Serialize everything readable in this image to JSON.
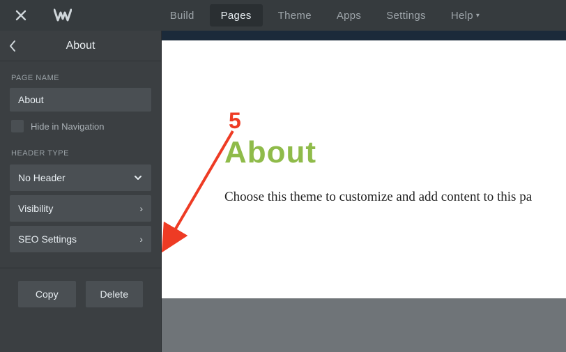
{
  "topnav": {
    "tabs": [
      "Build",
      "Pages",
      "Theme",
      "Apps",
      "Settings",
      "Help"
    ],
    "active_index": 1
  },
  "sidepanel": {
    "title": "About",
    "page_name_label": "PAGE NAME",
    "page_name_value": "About",
    "hide_nav_label": "Hide in Navigation",
    "hide_nav_checked": false,
    "header_type_label": "HEADER TYPE",
    "header_type_value": "No Header",
    "rows": [
      "Visibility",
      "SEO Settings"
    ],
    "buttons": {
      "copy": "Copy",
      "delete": "Delete"
    }
  },
  "page_preview": {
    "heading": "About",
    "body": "Choose this theme to customize and add content to this pa"
  },
  "annotation": {
    "label": "5",
    "color": "#ee3b24"
  }
}
